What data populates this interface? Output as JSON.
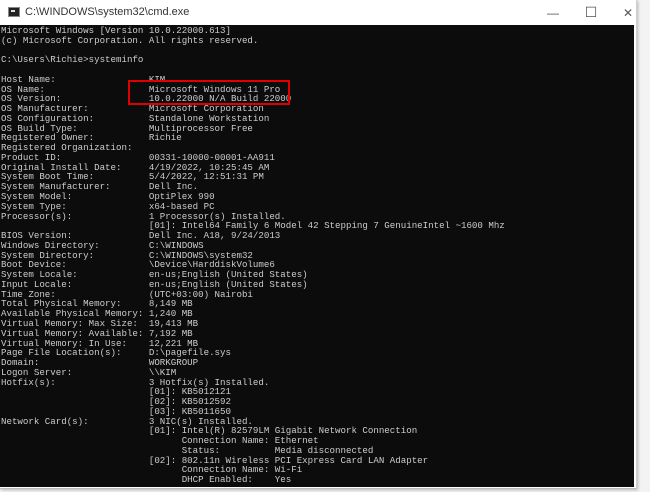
{
  "window": {
    "title": "C:\\WINDOWS\\system32\\cmd.exe",
    "minimize": "—",
    "maximize": "☐",
    "close": "✕"
  },
  "terminal": {
    "lines": [
      "Microsoft Windows [Version 10.0.22000.613]",
      "(c) Microsoft Corporation. All rights reserved.",
      "",
      "C:\\Users\\Richie>systeminfo",
      "",
      "Host Name:                 KIM",
      "OS Name:                   Microsoft Windows 11 Pro",
      "OS Version:                10.0.22000 N/A Build 22000",
      "OS Manufacturer:           Microsoft Corporation",
      "OS Configuration:          Standalone Workstation",
      "OS Build Type:             Multiprocessor Free",
      "Registered Owner:          Richie",
      "Registered Organization:",
      "Product ID:                00331-10000-00001-AA911",
      "Original Install Date:     4/19/2022, 10:25:45 AM",
      "System Boot Time:          5/4/2022, 12:51:31 PM",
      "System Manufacturer:       Dell Inc.",
      "System Model:              OptiPlex 990",
      "System Type:               x64-based PC",
      "Processor(s):              1 Processor(s) Installed.",
      "                           [01]: Intel64 Family 6 Model 42 Stepping 7 GenuineIntel ~1600 Mhz",
      "BIOS Version:              Dell Inc. A18, 9/24/2013",
      "Windows Directory:         C:\\WINDOWS",
      "System Directory:          C:\\WINDOWS\\system32",
      "Boot Device:               \\Device\\HarddiskVolume6",
      "System Locale:             en-us;English (United States)",
      "Input Locale:              en-us;English (United States)",
      "Time Zone:                 (UTC+03:00) Nairobi",
      "Total Physical Memory:     8,149 MB",
      "Available Physical Memory: 1,240 MB",
      "Virtual Memory: Max Size:  19,413 MB",
      "Virtual Memory: Available: 7,192 MB",
      "Virtual Memory: In Use:    12,221 MB",
      "Page File Location(s):     D:\\pagefile.sys",
      "Domain:                    WORKGROUP",
      "Logon Server:              \\\\KIM",
      "Hotfix(s):                 3 Hotfix(s) Installed.",
      "                           [01]: KB5012121",
      "                           [02]: KB5012592",
      "                           [03]: KB5011650",
      "Network Card(s):           3 NIC(s) Installed.",
      "                           [01]: Intel(R) 82579LM Gigabit Network Connection",
      "                                 Connection Name: Ethernet",
      "                                 Status:          Media disconnected",
      "                           [02]: 802.11n Wireless PCI Express Card LAN Adapter",
      "                                 Connection Name: Wi-Fi",
      "                                 DHCP Enabled:    Yes"
    ]
  },
  "colors": {
    "highlight": "#e00000",
    "terminal_bg": "#0c0c0c",
    "terminal_text": "#cccccc"
  }
}
